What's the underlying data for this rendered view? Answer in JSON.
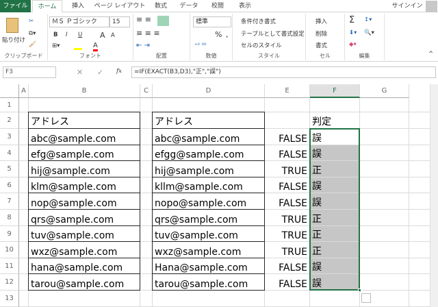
{
  "tabs": [
    "ファイル",
    "ホーム",
    "挿入",
    "ページ レイアウト",
    "数式",
    "データ",
    "校閲",
    "表示"
  ],
  "signin": "サインイン",
  "ribbon": {
    "clipboard": {
      "label": "クリップボード",
      "paste": "貼り付け"
    },
    "font": {
      "label": "フォント",
      "name": "ＭＳ Ｐゴシック",
      "size": "15",
      "bold": "B",
      "italic": "I",
      "underline": "U",
      "grow": "A",
      "shrink": "A",
      "color_letter": "A",
      "highlight_color": "#ffff00",
      "font_color": "#ff0000"
    },
    "alignment": {
      "label": "配置"
    },
    "number": {
      "label": "数値",
      "format": "標準",
      "percent": "%",
      "comma": ","
    },
    "styles": {
      "label": "スタイル",
      "conditional": "条件付き書式",
      "table": "テーブルとして書式設定",
      "cell_styles": "セルのスタイル"
    },
    "cells": {
      "label": "セル",
      "insert": "挿入",
      "delete": "削除",
      "format": "書式"
    },
    "editing": {
      "label": "編集",
      "sum": "Σ"
    }
  },
  "formula_bar": {
    "name_box": "F3",
    "cancel": "✕",
    "enter": "✓",
    "fx": "fx",
    "formula": "=IF(EXACT(B3,D3),\"正\",\"誤\")"
  },
  "columns": [
    "A",
    "B",
    "C",
    "D",
    "E",
    "F",
    "G"
  ],
  "rows": [
    "1",
    "2",
    "3",
    "4",
    "5",
    "6",
    "7",
    "8",
    "9",
    "10",
    "11",
    "12",
    "13"
  ],
  "headers": {
    "b": "アドレス",
    "d": "アドレス",
    "f": "判定"
  },
  "data": [
    {
      "b": "abc@sample.com",
      "d": "abc@sample.com",
      "e": "FALSE",
      "f": "誤"
    },
    {
      "b": "efg@sample.com",
      "d": "efgg@sample.com",
      "e": "FALSE",
      "f": "誤"
    },
    {
      "b": "hij@sample.com",
      "d": "hij@sample.com",
      "e": "TRUE",
      "f": "正"
    },
    {
      "b": "klm@sample.com",
      "d": "kllm@sample.com",
      "e": "FALSE",
      "f": "誤"
    },
    {
      "b": "nop@sample.com",
      "d": "nopo@sample.com",
      "e": "FALSE",
      "f": "誤"
    },
    {
      "b": "qrs@sample.com",
      "d": "qrs@sample.com",
      "e": "TRUE",
      "f": "正"
    },
    {
      "b": "tuv@sample.com",
      "d": "tuv@sample.com",
      "e": "TRUE",
      "f": "正"
    },
    {
      "b": "wxz@sample.com",
      "d": "wxz@sample.com",
      "e": "TRUE",
      "f": "正"
    },
    {
      "b": "hana@sample.com",
      "d": "Hana@sample.com",
      "e": "FALSE",
      "f": "誤"
    },
    {
      "b": "tarou@sample.com",
      "d": "tarou@sample.com",
      "e": "FALSE",
      "f": "誤"
    }
  ],
  "colors": {
    "accent": "#217346",
    "selection": "#c6c6c6"
  }
}
